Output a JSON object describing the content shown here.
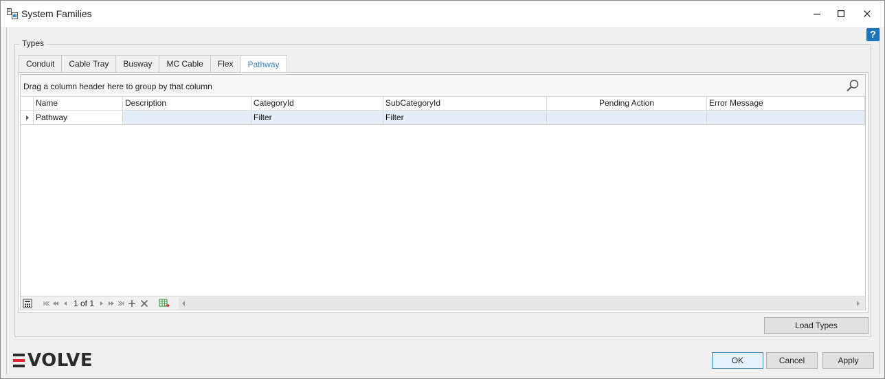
{
  "window": {
    "title": "System Families",
    "icon": "system-families-icon",
    "controls": {
      "minimize": "minimize-icon",
      "maximize": "maximize-icon",
      "close": "close-icon"
    }
  },
  "help": {
    "label": "?"
  },
  "types_group": {
    "legend": "Types",
    "tabs": [
      {
        "label": "Conduit",
        "active": false
      },
      {
        "label": "Cable Tray",
        "active": false
      },
      {
        "label": "Busway",
        "active": false
      },
      {
        "label": "MC Cable",
        "active": false
      },
      {
        "label": "Flex",
        "active": false
      },
      {
        "label": "Pathway",
        "active": true
      }
    ],
    "grid": {
      "group_panel_text": "Drag a column header here to group by that column",
      "columns": [
        "Name",
        "Description",
        "CategoryId",
        "SubCategoryId",
        "Pending Action",
        "Error Message"
      ],
      "rows": [
        {
          "name": "Pathway",
          "description": "",
          "category_id": "Filter",
          "subcategory_id": "Filter",
          "pending_action": "",
          "error_message": ""
        }
      ],
      "navigator": {
        "record_text": "1 of 1"
      }
    },
    "load_types_label": "Load Types"
  },
  "footer": {
    "logo_text": "EVOLVE",
    "ok_label": "OK",
    "cancel_label": "Cancel",
    "apply_label": "Apply"
  },
  "colors": {
    "accent": "#3d86c6",
    "selected_row": "#e3edf8",
    "help": "#1b75bc",
    "logo_red": "#e3262d"
  }
}
